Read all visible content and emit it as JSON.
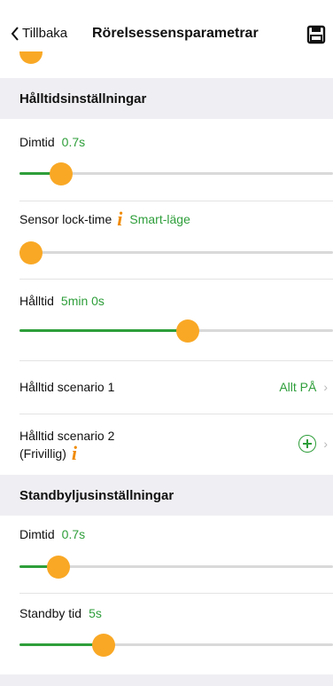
{
  "header": {
    "back_label": "Tillbaka",
    "title": "Rörelsessensparametrar"
  },
  "sections": {
    "hold": {
      "title": "Hålltidsinställningar",
      "dim_time": {
        "label": "Dimtid",
        "value": "0.7s",
        "level": 0.1
      },
      "sensor_lock": {
        "label": "Sensor lock-time",
        "value": "Smart-läge",
        "level": 0.0
      },
      "hold_time": {
        "label": "Hålltid",
        "value": "5min 0s",
        "level": 0.52
      },
      "scenario1": {
        "label": "Hålltid scenario 1",
        "value": "Allt PÅ"
      },
      "scenario2": {
        "line1": "Hålltid scenario 2",
        "line2": "(Frivillig)"
      }
    },
    "standby": {
      "title": "Standbyljusinställningar",
      "dim_time": {
        "label": "Dimtid",
        "value": "0.7s",
        "level": 0.09
      },
      "standby_time": {
        "label": "Standby tid",
        "value": "5s",
        "level": 0.24
      }
    }
  },
  "icons": {
    "back": "chevron-left-icon",
    "save": "floppy-disk-icon",
    "info": "info-icon",
    "add": "plus-circle-icon",
    "chevron": "chevron-right-icon"
  },
  "colors": {
    "accent_green": "#2e9e3a",
    "thumb_orange": "#f9a825",
    "info_orange": "#f08a00",
    "section_bg": "#efeff3"
  }
}
